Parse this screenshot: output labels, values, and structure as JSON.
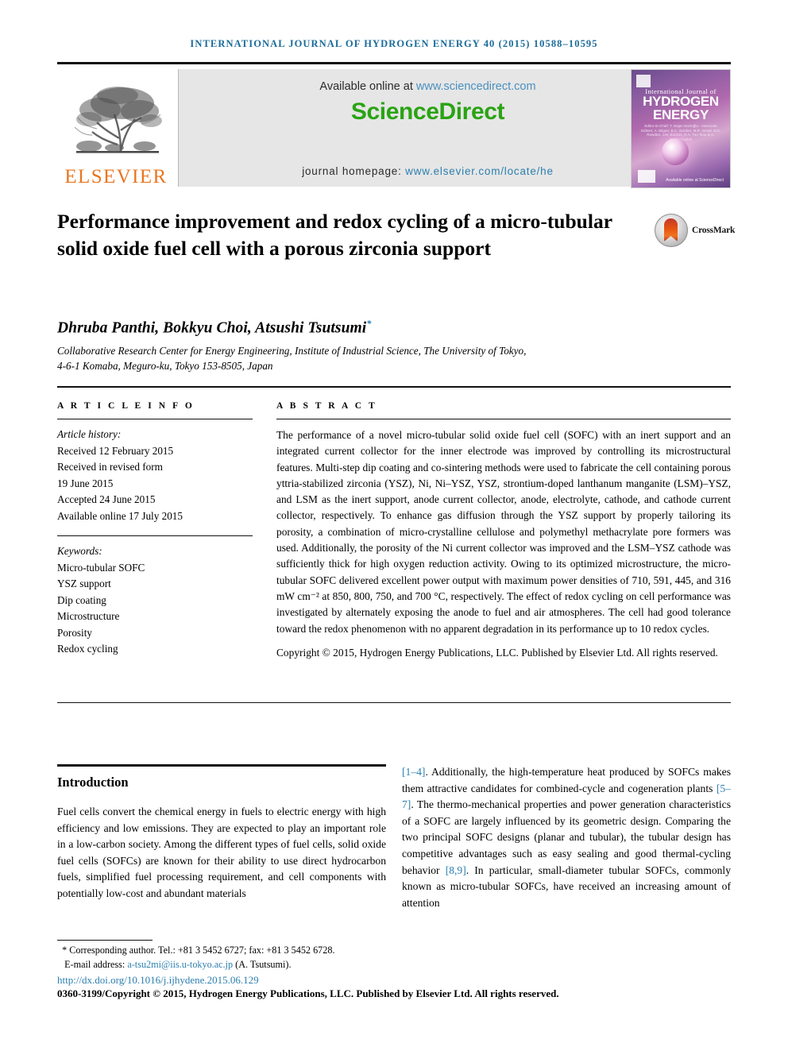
{
  "running_head": "INTERNATIONAL JOURNAL OF HYDROGEN ENERGY 40 (2015) 10588–10595",
  "masthead": {
    "publisher_name": "ELSEVIER",
    "publisher_logo_icon": "elsevier-tree-icon",
    "available_text": "Available online at ",
    "available_link": "www.sciencedirect.com",
    "sciencedirect_logo": "ScienceDirect",
    "homepage_label": "journal homepage: ",
    "homepage_link": "www.elsevier.com/locate/he",
    "cover": {
      "journal_prefix": "International Journal of",
      "journal_title_line1": "HYDROGEN",
      "journal_title_line2": "ENERGY",
      "editors": "Editor-in-Chief: T. Nejat Veziroğlu · Associate Editors: A. Bilgen, B.C. Gordon, M.R. Ismail, B.D. Rowden, J.M. Bockris, D.A. Tou Tsou & C. Sophomoulos",
      "sciencedirect_mark": "Available online at ScienceDirect"
    },
    "colors": {
      "link_blue": "#2c7fb0",
      "sciencedirect_green": "#2aa314",
      "elsevier_orange": "#E87722",
      "banner_grey": "#e6e6e6"
    }
  },
  "article": {
    "title": "Performance improvement and redox cycling of a micro-tubular solid oxide fuel cell with a porous zirconia support",
    "crossmark_label": "CrossMark",
    "authors": "Dhruba Panthi, Bokkyu Choi, Atsushi Tsutsumi",
    "corresponding_marker": "*",
    "affiliation_line1": "Collaborative Research Center for Energy Engineering, Institute of Industrial Science, The University of Tokyo,",
    "affiliation_line2": "4-6-1 Komaba, Meguro-ku, Tokyo 153-8505, Japan"
  },
  "article_info": {
    "heading": "A R T I C L E   I N F O",
    "history_label": "Article history:",
    "history": [
      "Received 12 February 2015",
      "Received in revised form",
      "19 June 2015",
      "Accepted 24 June 2015",
      "Available online 17 July 2015"
    ],
    "keywords_label": "Keywords:",
    "keywords": [
      "Micro-tubular SOFC",
      "YSZ support",
      "Dip coating",
      "Microstructure",
      "Porosity",
      "Redox cycling"
    ]
  },
  "abstract": {
    "heading": "A B S T R A C T",
    "body": "The performance of a novel micro-tubular solid oxide fuel cell (SOFC) with an inert support and an integrated current collector for the inner electrode was improved by controlling its microstructural features. Multi-step dip coating and co-sintering methods were used to fabricate the cell containing porous yttria-stabilized zirconia (YSZ), Ni, Ni–YSZ, YSZ, strontium-doped lanthanum manganite (LSM)–YSZ, and LSM as the inert support, anode current collector, anode, electrolyte, cathode, and cathode current collector, respectively. To enhance gas diffusion through the YSZ support by properly tailoring its porosity, a combination of micro-crystalline cellulose and polymethyl methacrylate pore formers was used. Additionally, the porosity of the Ni current collector was improved and the LSM–YSZ cathode was sufficiently thick for high oxygen reduction activity. Owing to its optimized microstructure, the micro-tubular SOFC delivered excellent power output with maximum power densities of 710, 591, 445, and 316 mW cm⁻² at 850, 800, 750, and 700 °C, respectively. The effect of redox cycling on cell performance was investigated by alternately exposing the anode to fuel and air atmospheres. The cell had good tolerance toward the redox phenomenon with no apparent degradation in its performance up to 10 redox cycles.",
    "copyright": "Copyright © 2015, Hydrogen Energy Publications, LLC. Published by Elsevier Ltd. All rights reserved."
  },
  "introduction": {
    "heading": "Introduction",
    "left_text": "Fuel cells convert the chemical energy in fuels to electric energy with high efficiency and low emissions. They are expected to play an important role in a low-carbon society. Among the different types of fuel cells, solid oxide fuel cells (SOFCs) are known for their ability to use direct hydrocarbon fuels, simplified fuel processing requirement, and cell components with potentially low-cost and abundant materials",
    "right_ref1": "[1–4]",
    "right_part1": ". Additionally, the high-temperature heat produced by SOFCs makes them attractive candidates for combined-cycle and cogeneration plants ",
    "right_ref2": "[5–7]",
    "right_part2": ". The thermo-mechanical properties and power generation characteristics of a SOFC are largely influenced by its geometric design. Comparing the two principal SOFC designs (planar and tubular), the tubular design has competitive advantages such as easy sealing and good thermal-cycling behavior ",
    "right_ref3": "[8,9]",
    "right_part3": ". In particular, small-diameter tubular SOFCs, commonly known as micro-tubular SOFCs, have received an increasing amount of attention"
  },
  "footer": {
    "corresponding_marker": "*",
    "corresponding_text": "Corresponding author. Tel.: +81 3 5452 6727; fax: +81 3 5452 6728.",
    "email_label": "E-mail address: ",
    "email": "a-tsu2mi@iis.u-tokyo.ac.jp",
    "email_suffix": " (A. Tsutsumi).",
    "doi": "http://dx.doi.org/10.1016/j.ijhydene.2015.06.129",
    "issn_line": "0360-3199/Copyright © 2015, Hydrogen Energy Publications, LLC. Published by Elsevier Ltd. All rights reserved."
  }
}
